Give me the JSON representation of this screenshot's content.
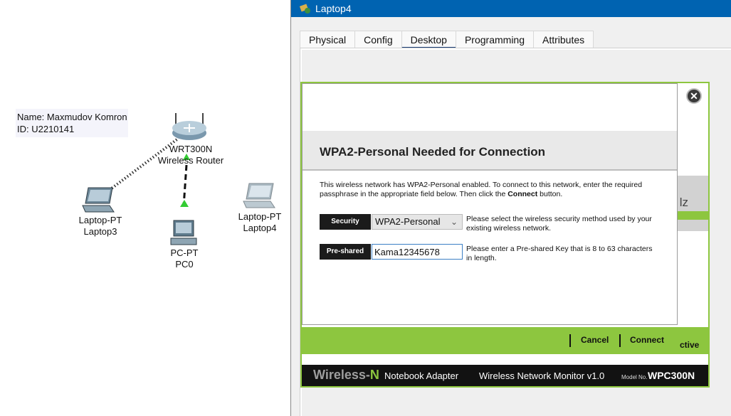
{
  "canvas": {
    "note": {
      "name": "Name: Maxmudov Komron",
      "id": "ID: U2210141"
    },
    "devices": [
      {
        "type": "Laptop-PT",
        "name": "Laptop3"
      },
      {
        "type": "WRT300N",
        "name": "Wireless Router"
      },
      {
        "type": "PC-PT",
        "name": "PC0"
      },
      {
        "type": "Laptop-PT",
        "name": "Laptop4"
      }
    ]
  },
  "window": {
    "title": "Laptop4",
    "tabs": [
      {
        "label": "Physical"
      },
      {
        "label": "Config"
      },
      {
        "label": "Desktop",
        "active": true
      },
      {
        "label": "Programming"
      },
      {
        "label": "Attributes"
      }
    ]
  },
  "dialog": {
    "title": "WPA2-Personal Needed for Connection",
    "description_part1": "This wireless network has WPA2-Personal enabled. To connect to this network, enter the required passphrase in the appropriate field below. Then click the ",
    "description_bold": "Connect",
    "description_part2": " button.",
    "security": {
      "label": "Security",
      "value": "WPA2-Personal",
      "help": "Please select the wireless security method used by your existing wireless network."
    },
    "psk": {
      "label": "Pre-shared Key",
      "value": "Kama12345678",
      "help": "Please enter a Pre-shared Key that is 8 to 63 characters in length."
    },
    "cancel": "Cancel",
    "connect": "Connect"
  },
  "app": {
    "background_text": "ctive",
    "partial_letter": "lz",
    "footer": {
      "brand_main": "Wireless-",
      "brand_n": "N",
      "adapter": "Notebook Adapter",
      "monitor": "Wireless Network Monitor  v1.0",
      "model_label": "Model No.",
      "model": "WPC300N"
    }
  },
  "colors": {
    "accent_green": "#8dc63f",
    "titlebar_blue": "#0063b1",
    "tab_active_underline": "#1a3c74"
  }
}
